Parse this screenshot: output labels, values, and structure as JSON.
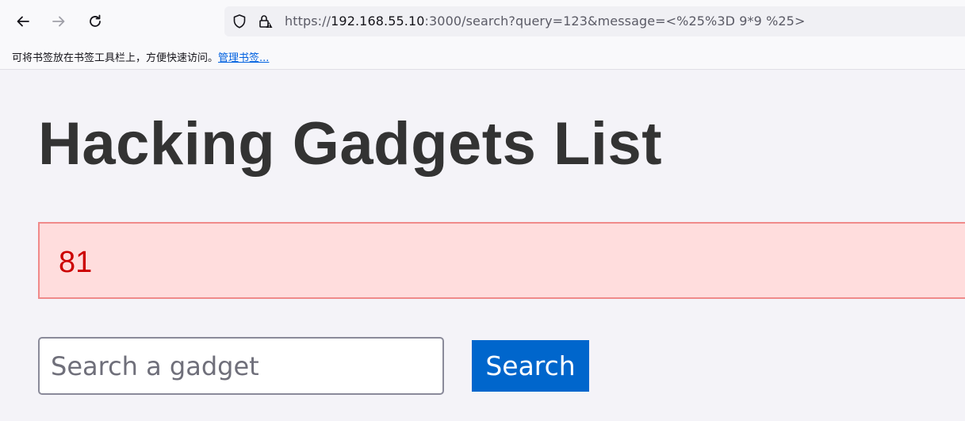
{
  "browser": {
    "url": {
      "scheme": "https://",
      "host": "192.168.55.10",
      "rest": ":3000/search?query=123&message=<%25%3D 9*9 %25>"
    },
    "bookmarks_bar": {
      "hint": "可将书签放在书签工具栏上，方便快速访问。",
      "manage_link": "管理书签..."
    },
    "icons": {
      "back": "back-arrow-icon",
      "forward": "forward-arrow-icon",
      "reload": "reload-icon",
      "tracking": "shield-icon",
      "security": "lock-warning-icon"
    }
  },
  "page": {
    "title": "Hacking Gadgets List",
    "alert": {
      "message": "81"
    },
    "search": {
      "placeholder": "Search a gadget",
      "button_label": "Search"
    }
  }
}
